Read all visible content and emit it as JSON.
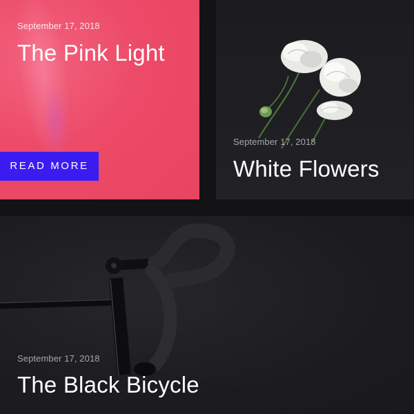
{
  "cards": [
    {
      "date": "September 17, 2018",
      "title": "The Pink Light",
      "button_label": "READ MORE",
      "accent_color": "#e8455f",
      "button_color": "#3a1cf0"
    },
    {
      "date": "September 17, 2018",
      "title": "White Flowers"
    },
    {
      "date": "September 17, 2018",
      "title": "The Black Bicycle"
    }
  ]
}
